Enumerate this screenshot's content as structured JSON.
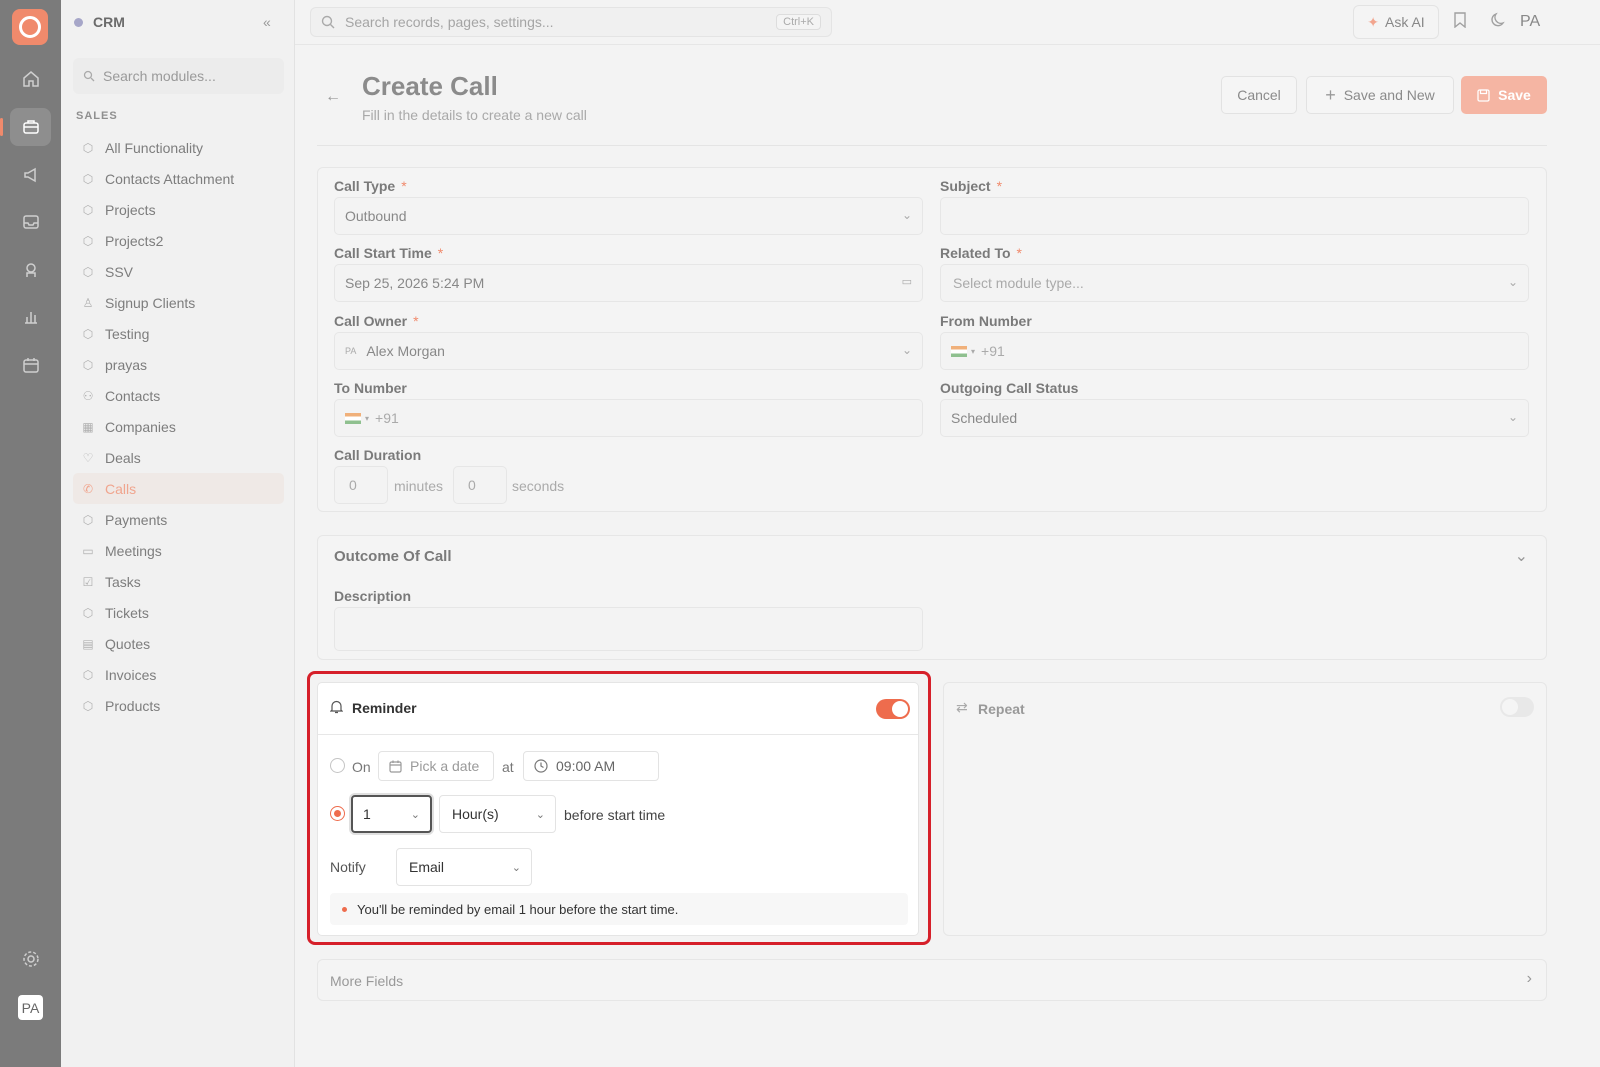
{
  "app": {
    "name": "CRM"
  },
  "sidebar": {
    "search_placeholder": "Search modules...",
    "section": "SALES",
    "items": [
      {
        "label": "All Functionality",
        "icon": "cube-icon"
      },
      {
        "label": "Contacts Attachment",
        "icon": "cube-icon"
      },
      {
        "label": "Projects",
        "icon": "cube-icon"
      },
      {
        "label": "Projects2",
        "icon": "cube-icon"
      },
      {
        "label": "SSV",
        "icon": "cube-icon"
      },
      {
        "label": "Signup Clients",
        "icon": "user-icon"
      },
      {
        "label": "Testing",
        "icon": "cube-icon"
      },
      {
        "label": "prayas",
        "icon": "cube-icon"
      },
      {
        "label": "Contacts",
        "icon": "users-icon"
      },
      {
        "label": "Companies",
        "icon": "building-icon"
      },
      {
        "label": "Deals",
        "icon": "handshake-icon"
      },
      {
        "label": "Calls",
        "icon": "phone-icon",
        "active": true
      },
      {
        "label": "Payments",
        "icon": "cube-icon"
      },
      {
        "label": "Meetings",
        "icon": "calendar-icon"
      },
      {
        "label": "Tasks",
        "icon": "checkbox-icon"
      },
      {
        "label": "Tickets",
        "icon": "cube-icon"
      },
      {
        "label": "Quotes",
        "icon": "document-icon"
      },
      {
        "label": "Invoices",
        "icon": "cube-icon"
      },
      {
        "label": "Products",
        "icon": "cube-icon"
      }
    ]
  },
  "topbar": {
    "search_placeholder": "Search records, pages, settings...",
    "shortcut": "Ctrl+K",
    "ask_ai": "Ask AI",
    "user_initials": "PA"
  },
  "header": {
    "title": "Create Call",
    "subtitle": "Fill in the details to create a new call",
    "cancel": "Cancel",
    "save_and_new": "Save and New",
    "save": "Save"
  },
  "form": {
    "call_type": {
      "label": "Call Type",
      "value": "Outbound"
    },
    "subject": {
      "label": "Subject",
      "value": ""
    },
    "call_start_time": {
      "label": "Call Start Time",
      "value": "Sep 25, 2026 5:24 PM"
    },
    "related_to": {
      "label": "Related To",
      "placeholder": "Select module type..."
    },
    "call_owner": {
      "label": "Call Owner",
      "initials": "PA",
      "value": "Alex Morgan"
    },
    "from_number": {
      "label": "From Number",
      "code": "+91"
    },
    "to_number": {
      "label": "To Number",
      "code": "+91"
    },
    "outgoing_status": {
      "label": "Outgoing Call Status",
      "value": "Scheduled"
    },
    "call_duration": {
      "label": "Call Duration",
      "minutes": "0",
      "minutes_label": "minutes",
      "seconds": "0",
      "seconds_label": "seconds"
    },
    "required_mark": "*"
  },
  "outcome": {
    "title": "Outcome Of Call",
    "description_label": "Description"
  },
  "reminder": {
    "title": "Reminder",
    "enabled": true,
    "on_label": "On",
    "date_placeholder": "Pick a date",
    "at_label": "at",
    "time": "09:00 AM",
    "amount": "1",
    "unit": "Hour(s)",
    "before_text": "before start time",
    "notify_label": "Notify",
    "notify_value": "Email",
    "note": "You'll be reminded by email 1 hour before the start time."
  },
  "repeat": {
    "title": "Repeat",
    "enabled": false
  },
  "more_fields": "More Fields",
  "colors": {
    "accent": "#ee6c4d",
    "highlight": "#d6202a"
  }
}
